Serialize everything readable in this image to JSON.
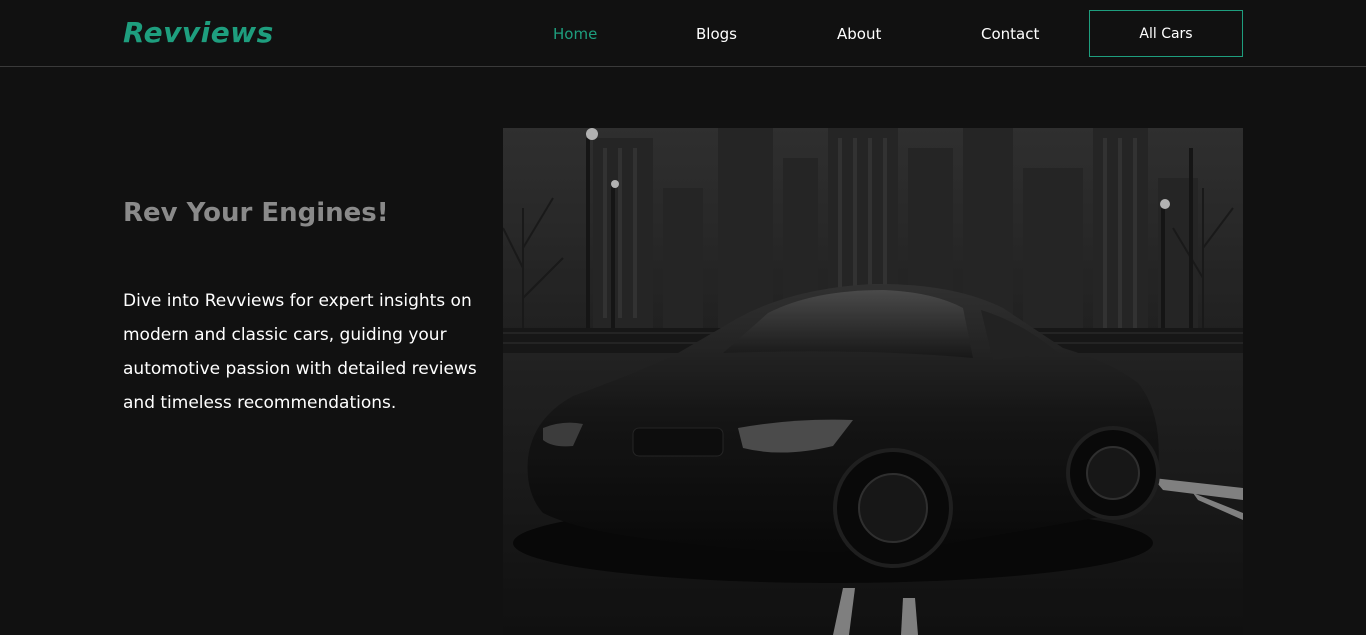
{
  "header": {
    "logo": "Revviews",
    "nav": [
      {
        "label": "Home",
        "active": true
      },
      {
        "label": "Blogs",
        "active": false
      },
      {
        "label": "About",
        "active": false
      },
      {
        "label": "Contact",
        "active": false
      }
    ],
    "cta_label": "All Cars"
  },
  "hero": {
    "title": "Rev Your Engines!",
    "description": "Dive into Revviews for expert insights on modern and classic cars, guiding your automotive passion with detailed reviews and timeless recommendations.",
    "image_icon": "car-photo-icon"
  },
  "colors": {
    "background": "#111111",
    "accent": "#1e9e7e",
    "title": "#8a8a8a",
    "text": "#ffffff"
  }
}
